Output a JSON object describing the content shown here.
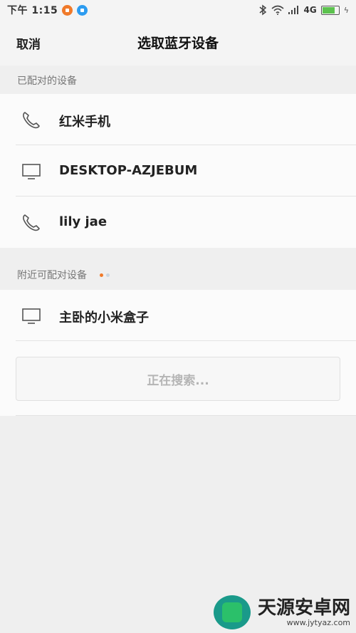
{
  "status_bar": {
    "time": "下午 1:15",
    "network": "4G",
    "notification_icons": [
      "app-notification-icon",
      "app-notification-icon"
    ],
    "icons": [
      "bluetooth-icon",
      "wifi-icon",
      "signal-icon",
      "battery-icon"
    ],
    "battery_level": 0.7
  },
  "header": {
    "cancel_label": "取消",
    "title": "选取蓝牙设备"
  },
  "paired_section": {
    "title": "已配对的设备",
    "devices": [
      {
        "name": "红米手机",
        "icon": "phone-icon"
      },
      {
        "name": "DESKTOP-AZJEBUM",
        "icon": "monitor-icon"
      },
      {
        "name": "lily jae",
        "icon": "phone-icon"
      }
    ]
  },
  "nearby_section": {
    "title": "附近可配对设备",
    "devices": [
      {
        "name": "主卧的小米盒子",
        "icon": "monitor-icon"
      }
    ],
    "searching_label": "正在搜索..."
  },
  "watermark": {
    "name": "天源安卓网",
    "url": "www.jytyaz.com"
  },
  "colors": {
    "background": "#efefef",
    "list_background": "#fbfbfb",
    "accent_orange": "#f07a2a",
    "battery_green": "#5cc24e"
  }
}
